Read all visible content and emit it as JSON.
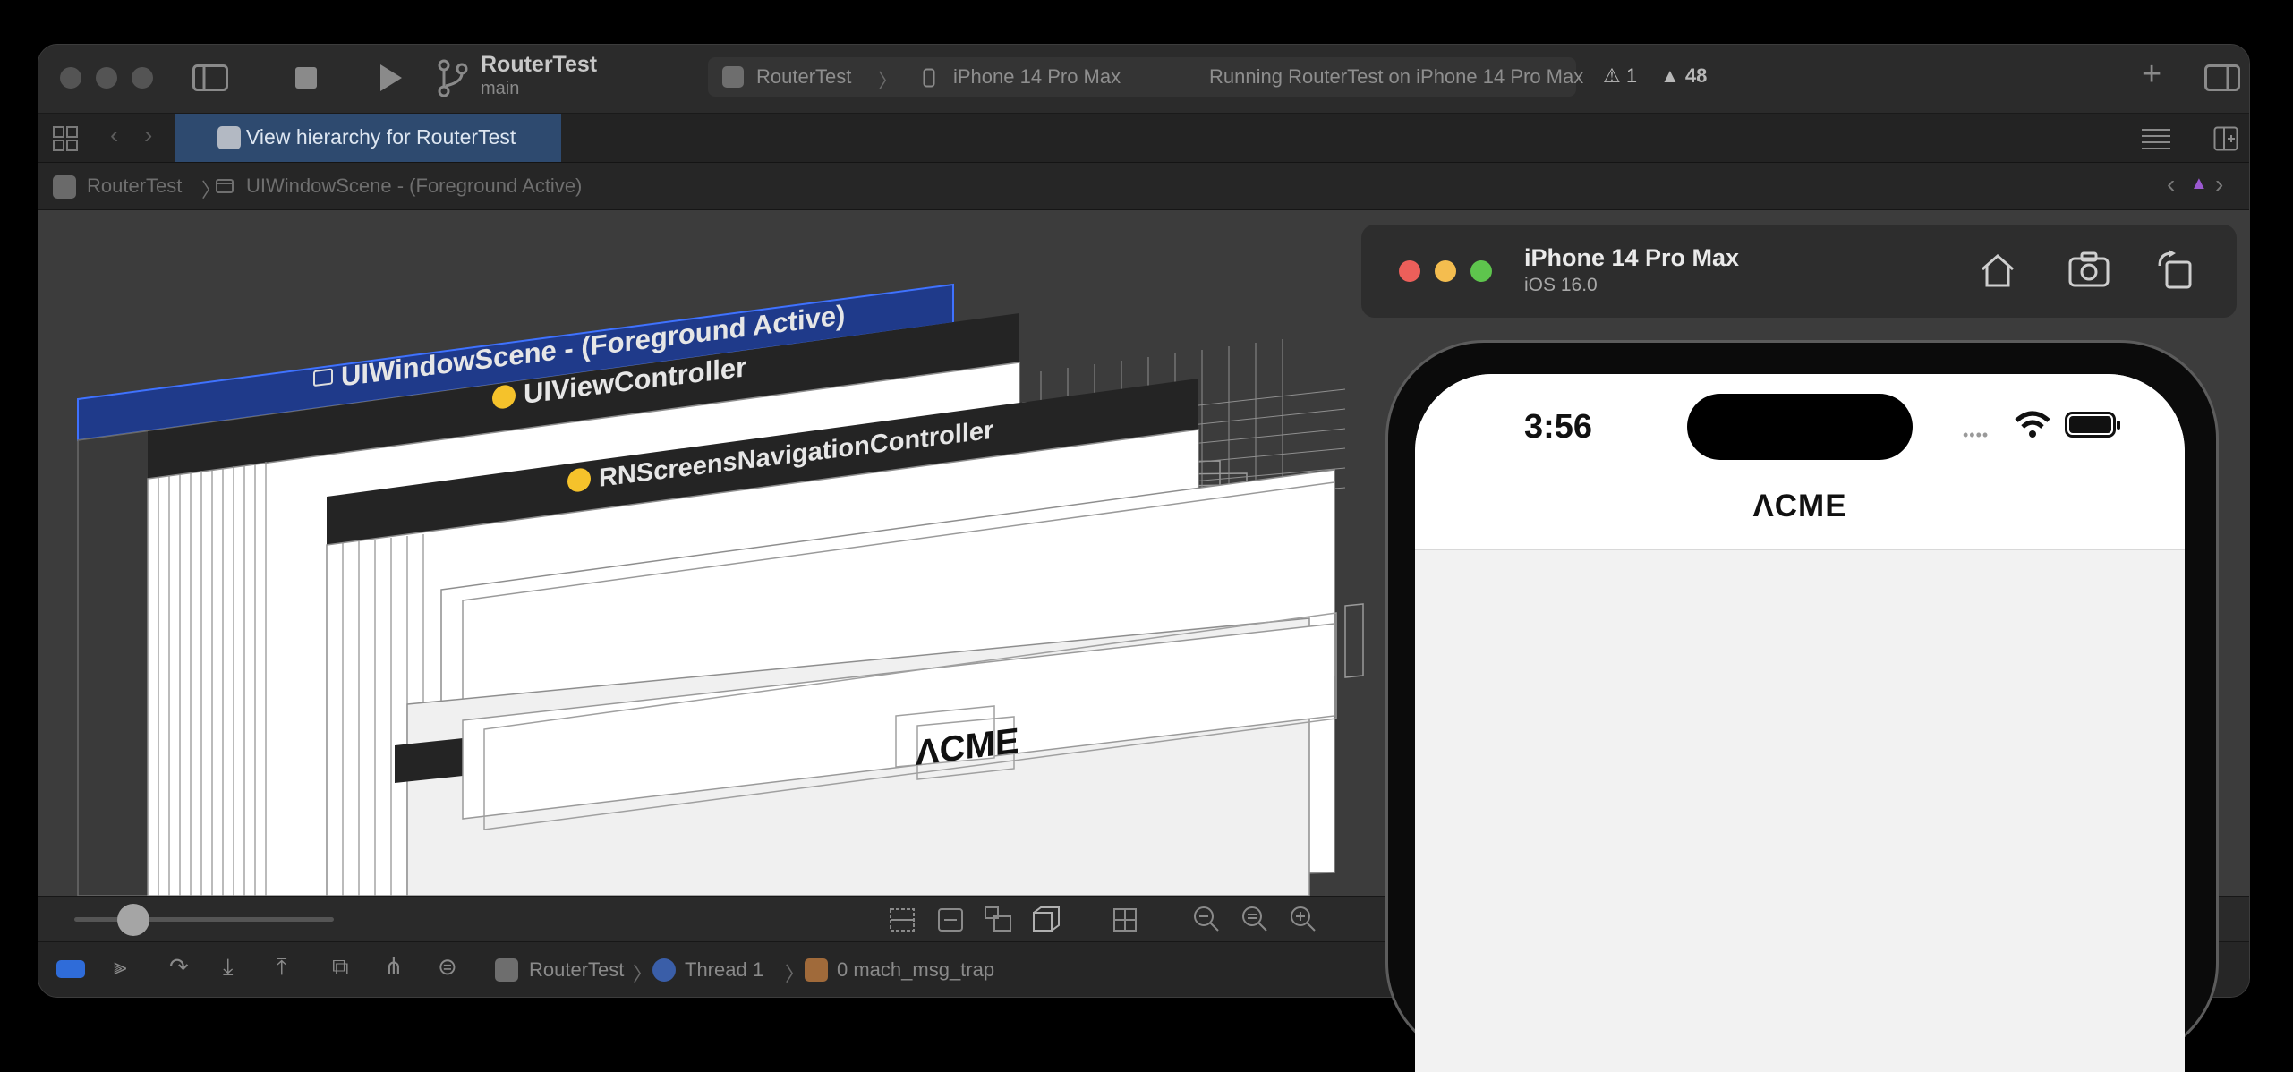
{
  "toolbar": {
    "scheme_title": "RouterTest",
    "scheme_branch": "main",
    "activity": {
      "target": "RouterTest",
      "device": "iPhone 14 Pro Max",
      "status": "Running RouterTest on iPhone 14 Pro Max",
      "warnings": "1",
      "issues": "48"
    }
  },
  "tab": {
    "label": "View hierarchy for RouterTest"
  },
  "breadcrumb": {
    "app": "RouterTest",
    "scene": "UIWindowScene - (Foreground Active)"
  },
  "hierarchy_labels": {
    "scene": "UIWindowScene - (Foreground Active)",
    "view_controller": "UIViewController",
    "nav_controller": "RNScreensNavigationController",
    "logo": "ΛCME"
  },
  "debug": {
    "app": "RouterTest",
    "thread": "Thread 1",
    "frame": "0 mach_msg_trap"
  },
  "simulator": {
    "device": "iPhone 14 Pro Max",
    "os": "iOS 16.0"
  },
  "phone": {
    "time": "3:56",
    "app_logo": "ΛCME"
  },
  "colors": {
    "accent": "#2e4a6f",
    "selection": "#1f3a8a",
    "warning": "#f5c22b",
    "toolbar": "#2b2b2b"
  }
}
